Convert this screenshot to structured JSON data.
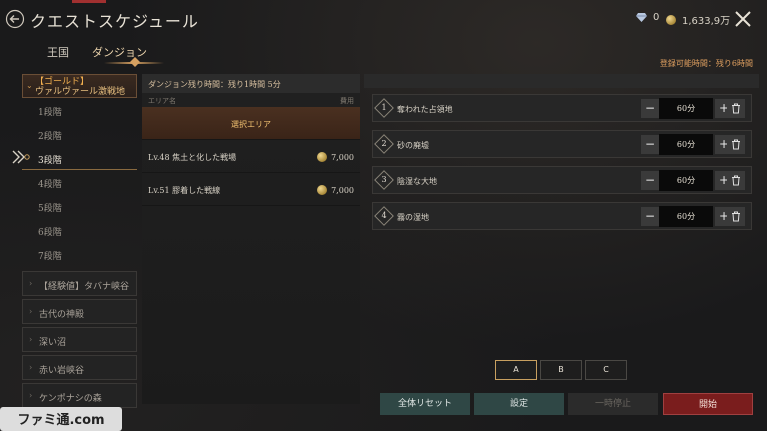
{
  "header": {
    "title": "クエストスケジュール",
    "gems": "0",
    "gold": "1,633,9万"
  },
  "tabs": [
    {
      "label": "王国"
    },
    {
      "label": "ダンジョン"
    }
  ],
  "sidebar": {
    "active_category": {
      "line1": "【ゴールド】",
      "line2": "ヴァルヴァール激戦地"
    },
    "floors": [
      "1段階",
      "2段階",
      "3段階",
      "4段階",
      "5段階",
      "6段階",
      "7段階"
    ],
    "selected_floor": "3段階",
    "categories": [
      "【経験値】タバナ峡谷",
      "古代の神殿",
      "深い沼",
      "赤い岩峡谷",
      "ケンポナシの森"
    ]
  },
  "dungeon": {
    "remaining": "ダンジョン残り時間：残り1時間 5分",
    "col_area": "エリア名",
    "col_cost": "費用",
    "selected_label": "選択エリア",
    "rows": [
      {
        "name": "",
        "cost": "",
        "selected": true
      },
      {
        "name": "Lv.48 焦土と化した戦場",
        "cost": "7,000"
      },
      {
        "name": "Lv.51 膠着した戦線",
        "cost": "7,000"
      }
    ]
  },
  "schedule": {
    "registrable_time": "登録可能時間：残り6時間",
    "slots": [
      {
        "num": "1",
        "name": "奪われた占領地",
        "value": "60分"
      },
      {
        "num": "2",
        "name": "砂の廃墟",
        "value": "60分"
      },
      {
        "num": "3",
        "name": "陰湿な大地",
        "value": "60分"
      },
      {
        "num": "4",
        "name": "霧の湿地",
        "value": "60分"
      }
    ],
    "minus": "−",
    "plus": "+"
  },
  "presets": [
    {
      "label": "A",
      "active": true
    },
    {
      "label": "B"
    },
    {
      "label": "C"
    }
  ],
  "buttons": {
    "reset": "全体リセット",
    "settings": "設定",
    "pause": "一時停止",
    "start": "開始"
  },
  "watermark": "ファミ通.com",
  "colors": {
    "accent_gold": "#f2b050",
    "start_red": "#7a1d1d",
    "teal_button": "#2f4745"
  }
}
